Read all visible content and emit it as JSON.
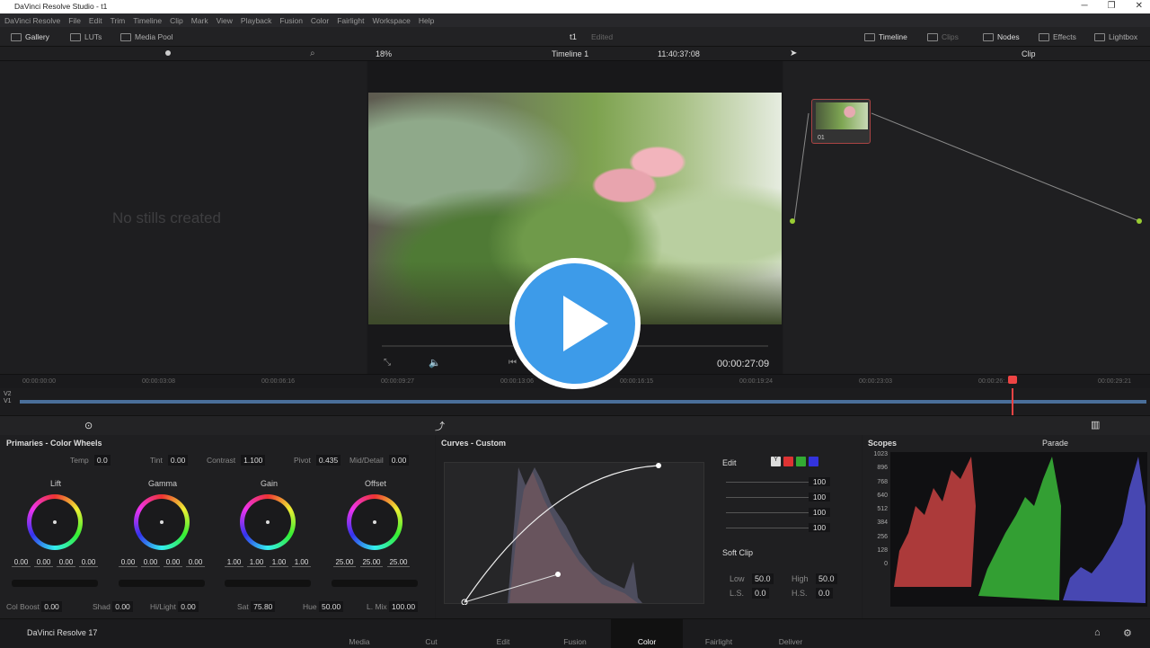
{
  "window": {
    "title": "DaVinci Resolve Studio - t1",
    "controls": [
      "─",
      "❐",
      "✕"
    ]
  },
  "menu": [
    "DaVinci Resolve",
    "File",
    "Edit",
    "Trim",
    "Timeline",
    "Clip",
    "Mark",
    "View",
    "Playback",
    "Fusion",
    "Color",
    "Fairlight",
    "Workspace",
    "Help"
  ],
  "toolbar": {
    "gallery": "Gallery",
    "luts": "LUTs",
    "media_pool": "Media Pool",
    "project": "t1",
    "status": "Edited",
    "timeline": "Timeline",
    "clips": "Clips",
    "nodes": "Nodes",
    "effects": "Effects",
    "lightbox": "Lightbox"
  },
  "viewer": {
    "zoom": "18%",
    "timeline_name": "Timeline 1",
    "timecode_top": "11:40:37:08",
    "timecode": "00:00:27:09",
    "clip_mode": "Clip"
  },
  "gallery": {
    "empty_text": "No stills created"
  },
  "node": {
    "label": "01"
  },
  "ruler": [
    "00:00:00:00",
    "00:00:03:08",
    "00:00:06:16",
    "00:00:09:27",
    "00:00:13:06",
    "00:00:16:15",
    "00:00:19:24",
    "00:00:23:03",
    "00:00:26:...",
    "00:00:29:21"
  ],
  "tracks": [
    "V2",
    "V1"
  ],
  "primaries": {
    "title": "Primaries - Color Wheels",
    "temp_label": "Temp",
    "temp": "0.0",
    "tint_label": "Tint",
    "tint": "0.00",
    "contrast_label": "Contrast",
    "contrast": "1.100",
    "pivot_label": "Pivot",
    "pivot": "0.435",
    "middetail_label": "Mid/Detail",
    "middetail": "0.00",
    "wheels": [
      {
        "name": "Lift",
        "values": [
          "0.00",
          "0.00",
          "0.00",
          "0.00"
        ]
      },
      {
        "name": "Gamma",
        "values": [
          "0.00",
          "0.00",
          "0.00",
          "0.00"
        ]
      },
      {
        "name": "Gain",
        "values": [
          "1.00",
          "1.00",
          "1.00",
          "1.00"
        ]
      },
      {
        "name": "Offset",
        "values": [
          "25.00",
          "25.00",
          "25.00"
        ]
      }
    ],
    "colboost_label": "Col Boost",
    "colboost": "0.00",
    "shad_label": "Shad",
    "shad": "0.00",
    "hilight_label": "Hi/Light",
    "hilight": "0.00",
    "sat_label": "Sat",
    "sat": "75.80",
    "hue_label": "Hue",
    "hue": "50.00",
    "lmix_label": "L. Mix",
    "lmix": "100.00"
  },
  "curves": {
    "title": "Curves - Custom",
    "edit_label": "Edit",
    "channels": [
      "Y",
      "R",
      "G",
      "B"
    ],
    "intensities": [
      "100",
      "100",
      "100",
      "100"
    ],
    "softclip_label": "Soft Clip",
    "low_label": "Low",
    "low": "50.0",
    "high_label": "High",
    "high": "50.0",
    "ls_label": "L.S.",
    "ls": "0.0",
    "hs_label": "H.S.",
    "hs": "0.0"
  },
  "scopes": {
    "title": "Scopes",
    "mode": "Parade",
    "scale": [
      "1023",
      "896",
      "768",
      "640",
      "512",
      "384",
      "256",
      "128",
      "0"
    ]
  },
  "pages": [
    "Media",
    "Cut",
    "Edit",
    "Fusion",
    "Color",
    "Fairlight",
    "Deliver"
  ],
  "active_page": "Color",
  "app_version": "DaVinci Resolve 17"
}
